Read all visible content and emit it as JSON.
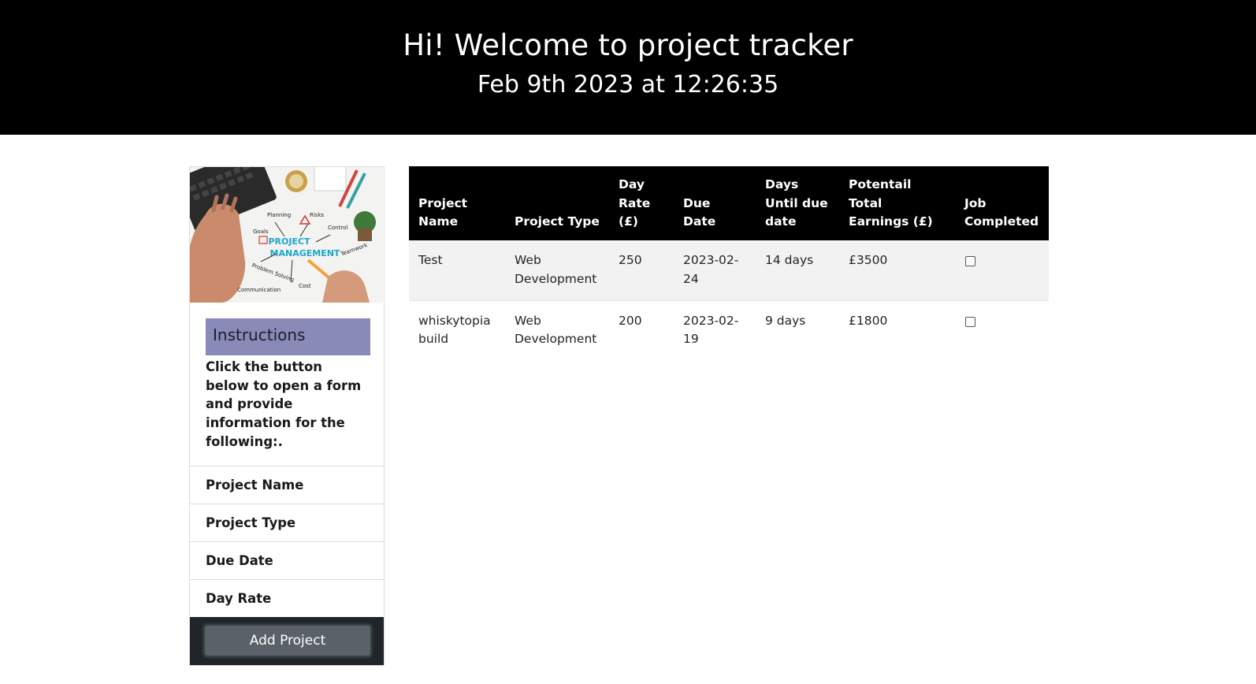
{
  "header": {
    "title": "Hi! Welcome to project tracker",
    "datetime": "Feb 9th 2023 at 12:26:35"
  },
  "sidebar": {
    "image_alt": "project-management-image",
    "image_words": [
      "Planning",
      "Risks",
      "Goals",
      "Control",
      "PROJECT",
      "MANAGEMENT",
      "Teamwork",
      "Problem Solving",
      "Communication",
      "Cost"
    ],
    "instructions_title": "Instructions",
    "instructions_text": "Click the button below to open a form and provide information for the following:.",
    "fields": [
      "Project Name",
      "Project Type",
      "Due Date",
      "Day Rate"
    ],
    "add_button_label": "Add Project"
  },
  "table": {
    "headers": {
      "project_name": "Project Name",
      "project_type": "Project Type",
      "day_rate": "Day Rate (£)",
      "due_date": "Due Date",
      "days_until": "Days Until due date",
      "total_earnings": "Potentail Total Earnings (£)",
      "job_completed": "Job Completed"
    },
    "rows": [
      {
        "project_name": "Test",
        "project_type": "Web Development",
        "day_rate": "250",
        "due_date": "2023-02-24",
        "days_until": "14 days",
        "total_earnings": "£3500",
        "completed": false
      },
      {
        "project_name": "whiskytopia build",
        "project_type": "Web Development",
        "day_rate": "200",
        "due_date": "2023-02-19",
        "days_until": "9 days",
        "total_earnings": "£1800",
        "completed": false
      }
    ]
  }
}
